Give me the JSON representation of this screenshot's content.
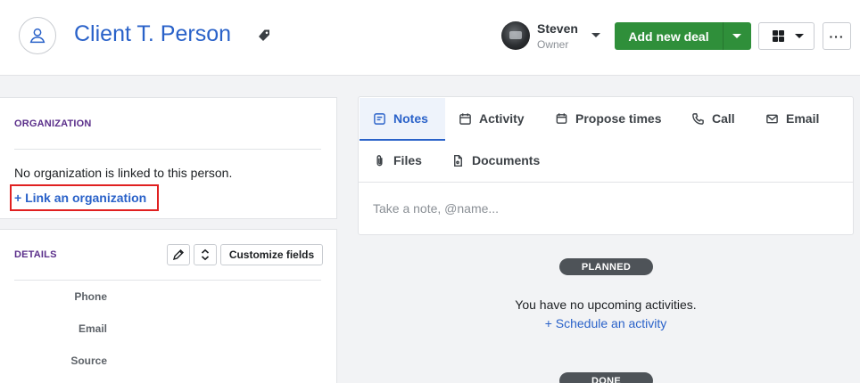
{
  "header": {
    "title": "Client T. Person",
    "user": {
      "name": "Steven",
      "role": "Owner"
    },
    "add_deal_label": "Add new deal",
    "more_label": "···"
  },
  "organization": {
    "section_title": "ORGANIZATION",
    "empty_text": "No organization is linked to this person.",
    "link_label": "+ Link an organization"
  },
  "details": {
    "section_title": "DETAILS",
    "customize_label": "Customize fields",
    "fields": [
      "Phone",
      "Email",
      "Source"
    ]
  },
  "composer": {
    "tabs": [
      {
        "label": "Notes",
        "icon": "note-icon"
      },
      {
        "label": "Activity",
        "icon": "calendar-icon"
      },
      {
        "label": "Propose times",
        "icon": "propose-times-icon"
      },
      {
        "label": "Call",
        "icon": "phone-icon"
      },
      {
        "label": "Email",
        "icon": "mail-icon"
      },
      {
        "label": "Files",
        "icon": "paperclip-icon"
      },
      {
        "label": "Documents",
        "icon": "document-icon"
      }
    ],
    "placeholder": "Take a note, @name..."
  },
  "timeline": {
    "planned_label": "PLANNED",
    "empty_text": "You have no upcoming activities.",
    "schedule_link": "+ Schedule an activity",
    "done_label": "DONE"
  },
  "colors": {
    "accent": "#2a62c9",
    "primary_button": "#2f8f3a",
    "section_title": "#5a2e8a",
    "highlight_border": "#e02020"
  }
}
